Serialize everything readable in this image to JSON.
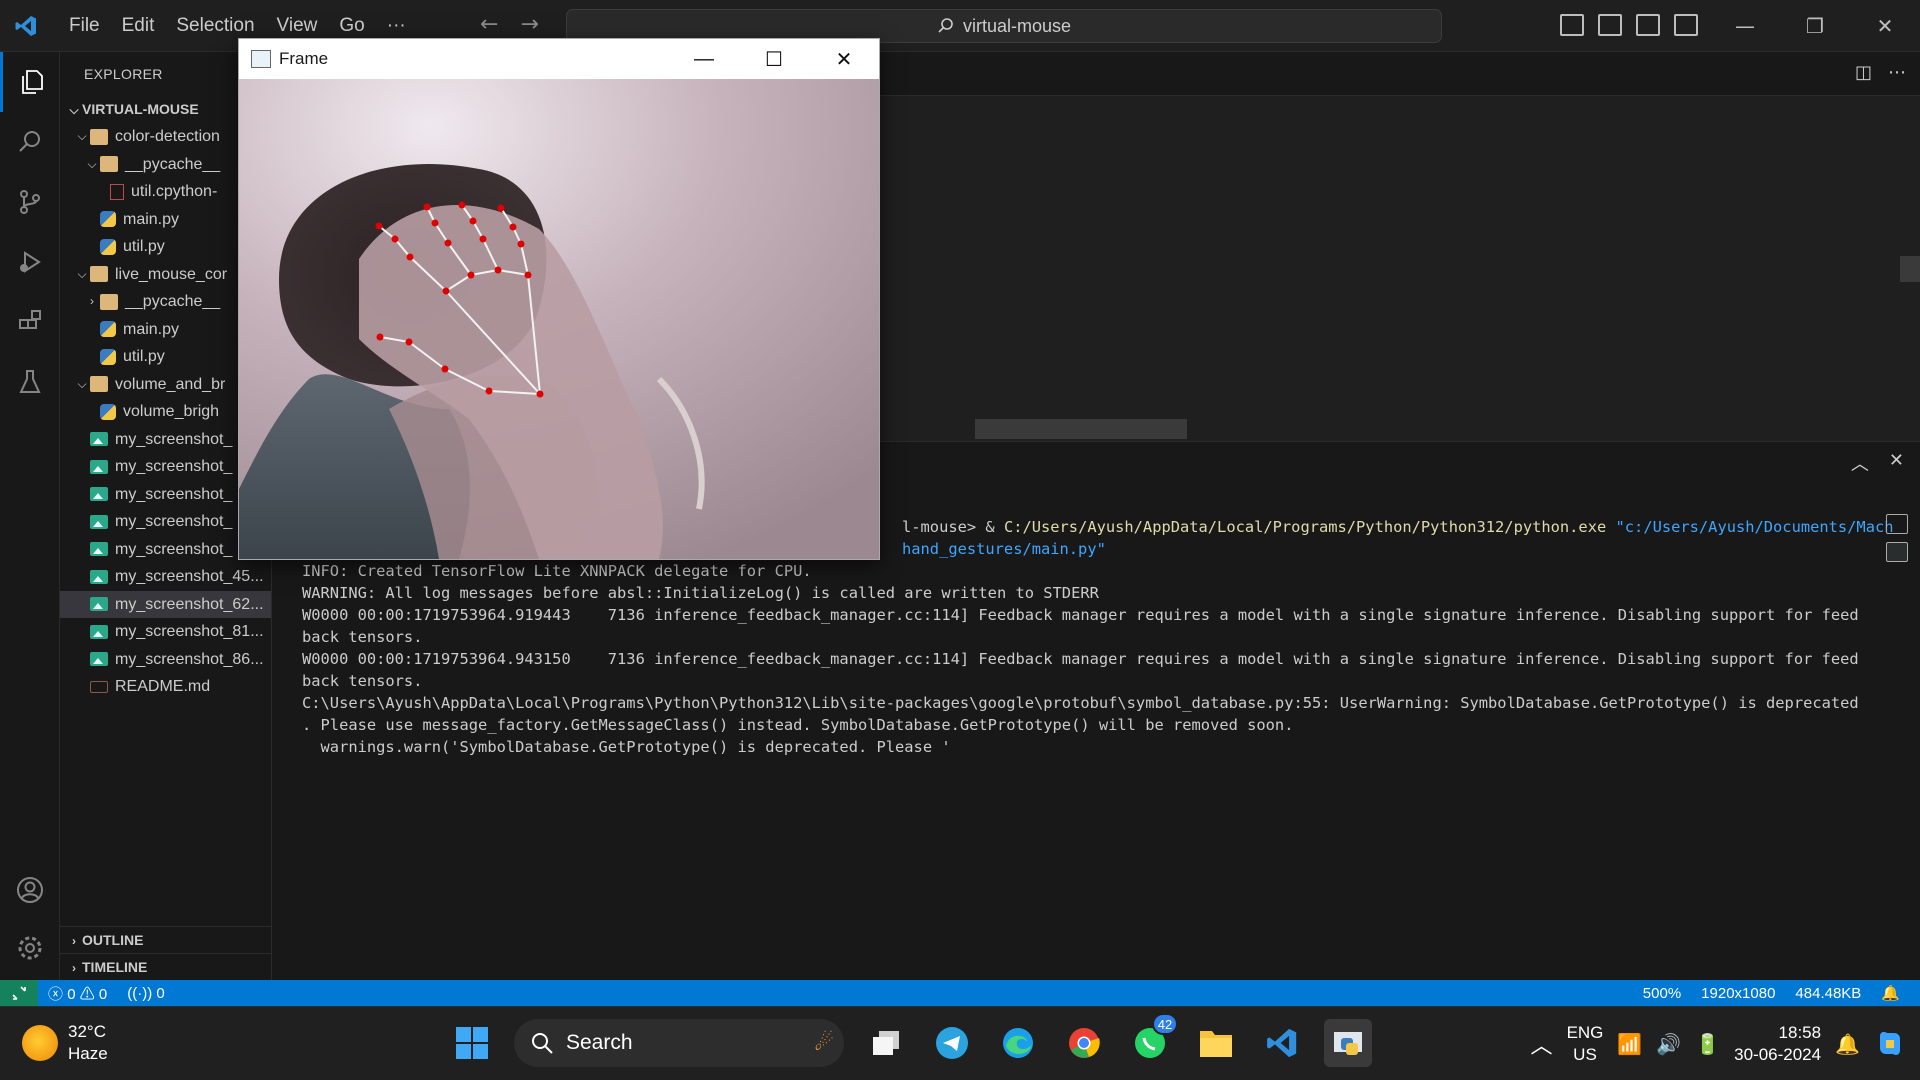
{
  "titlebar": {
    "menu": [
      "File",
      "Edit",
      "Selection",
      "View",
      "Go",
      "···"
    ],
    "search_text": "virtual-mouse"
  },
  "sidebar": {
    "title": "EXPLORER",
    "root": "VIRTUAL-MOUSE",
    "items": [
      {
        "label": "color-detection",
        "type": "folder",
        "expanded": true,
        "depth": 1
      },
      {
        "label": "__pycache__",
        "type": "pyfolder",
        "expanded": true,
        "depth": 2
      },
      {
        "label": "util.cpython-",
        "type": "file",
        "depth": 3
      },
      {
        "label": "main.py",
        "type": "py",
        "depth": 2
      },
      {
        "label": "util.py",
        "type": "py",
        "depth": 2
      },
      {
        "label": "live_mouse_cor",
        "type": "folder",
        "expanded": true,
        "depth": 1
      },
      {
        "label": "__pycache__",
        "type": "pyfolder",
        "expanded": false,
        "depth": 2
      },
      {
        "label": "main.py",
        "type": "py",
        "depth": 2
      },
      {
        "label": "util.py",
        "type": "py",
        "depth": 2
      },
      {
        "label": "volume_and_br",
        "type": "folder",
        "expanded": true,
        "depth": 1
      },
      {
        "label": "volume_brigh",
        "type": "py",
        "depth": 2
      },
      {
        "label": "my_screenshot_",
        "type": "img",
        "depth": 1
      },
      {
        "label": "my_screenshot_",
        "type": "img",
        "depth": 1
      },
      {
        "label": "my_screenshot_",
        "type": "img",
        "depth": 1
      },
      {
        "label": "my_screenshot_",
        "type": "img",
        "depth": 1
      },
      {
        "label": "my_screenshot_",
        "type": "img",
        "depth": 1
      },
      {
        "label": "my_screenshot_45...",
        "type": "img",
        "depth": 1
      },
      {
        "label": "my_screenshot_62...",
        "type": "img",
        "depth": 1,
        "selected": true
      },
      {
        "label": "my_screenshot_81...",
        "type": "img",
        "depth": 1
      },
      {
        "label": "my_screenshot_86...",
        "type": "img",
        "depth": 1
      },
      {
        "label": "README.md",
        "type": "md",
        "depth": 1
      }
    ],
    "outline": "OUTLINE",
    "timeline": "TIMELINE"
  },
  "terminal": {
    "line0_prompt": "l-mouse> & ",
    "line0_exe": "C:/Users/Ayush/AppData/Local/Programs/Python/Python312/python.exe",
    "line0_arg": "\"c:/Users/Ayush/Documents/Mach",
    "line1_arg": "hand_gestures/main.py\"",
    "lines": [
      "INFO: Created TensorFlow Lite XNNPACK delegate for CPU.",
      "WARNING: All log messages before absl::InitializeLog() is called are written to STDERR",
      "W0000 00:00:1719753964.919443    7136 inference_feedback_manager.cc:114] Feedback manager requires a model with a single signature inference. Disabling support for feed",
      "back tensors.",
      "W0000 00:00:1719753964.943150    7136 inference_feedback_manager.cc:114] Feedback manager requires a model with a single signature inference. Disabling support for feed",
      "back tensors.",
      "C:\\Users\\Ayush\\AppData\\Local\\Programs\\Python\\Python312\\Lib\\site-packages\\google\\protobuf\\symbol_database.py:55: UserWarning: SymbolDatabase.GetPrototype() is deprecated",
      ". Please use message_factory.GetMessageClass() instead. SymbolDatabase.GetPrototype() will be removed soon.",
      "  warnings.warn('SymbolDatabase.GetPrototype() is deprecated. Please '"
    ]
  },
  "statusbar": {
    "errors": "0",
    "warnings": "0",
    "ports": "0",
    "zoom": "500%",
    "dimensions": "1920x1080",
    "filesize": "484.48KB"
  },
  "frame_window": {
    "title": "Frame"
  },
  "taskbar": {
    "temperature": "32°C",
    "condition": "Haze",
    "search_label": "Search",
    "whatsapp_badge": "42",
    "lang_line1": "ENG",
    "lang_line2": "US",
    "time": "18:58",
    "date": "30-06-2024"
  },
  "colors": {
    "accent": "#0078d4",
    "remote": "#16825d",
    "landmark": "#e00000"
  }
}
